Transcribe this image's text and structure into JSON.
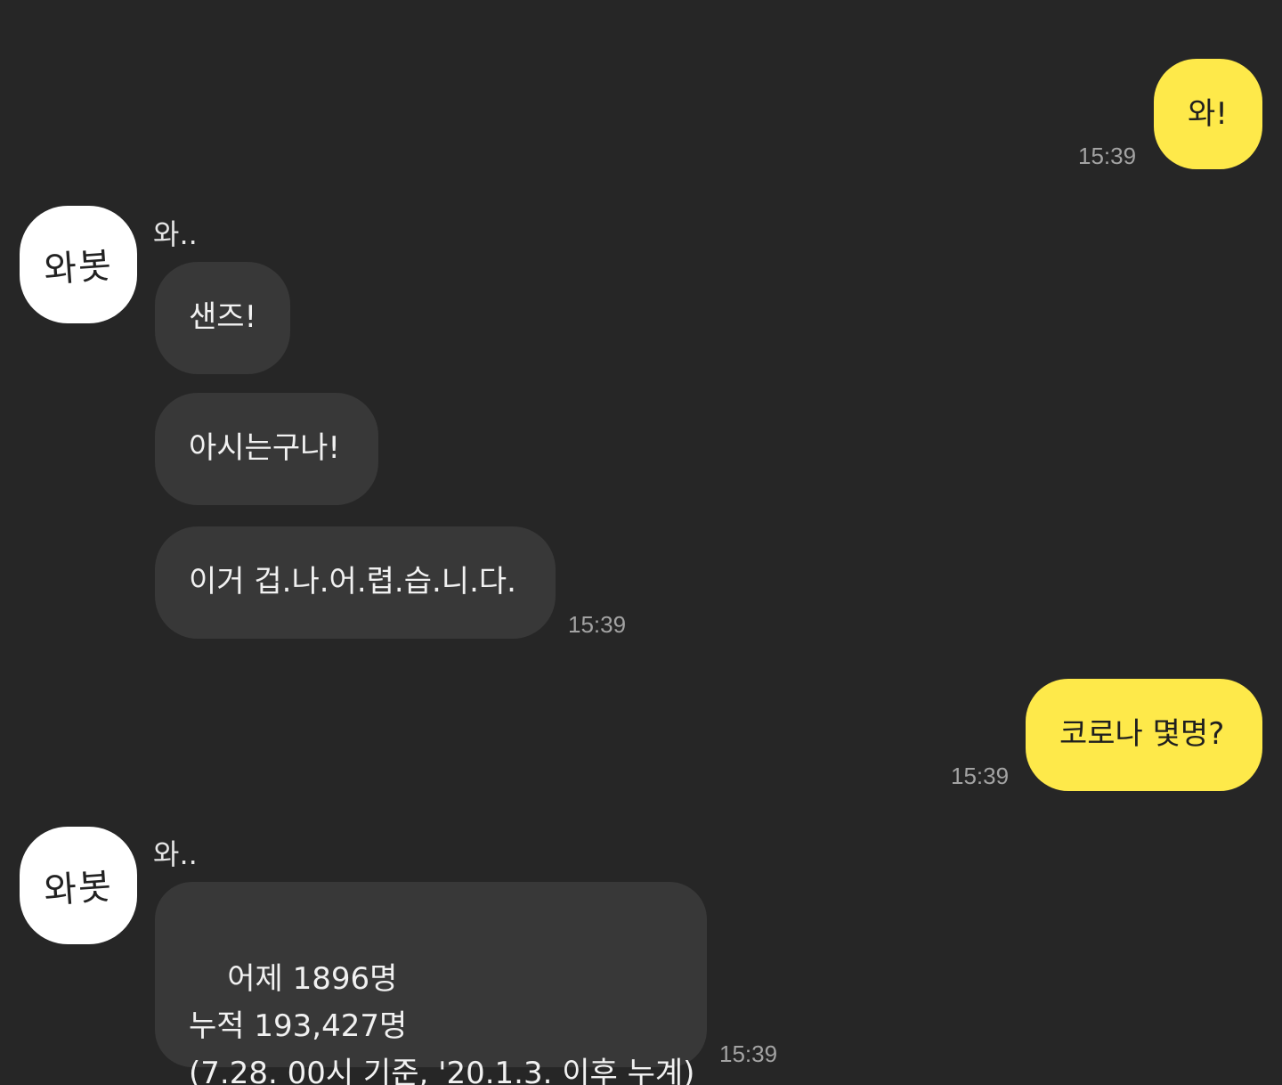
{
  "messages": {
    "m1": {
      "text": "와!",
      "time": "15:39"
    },
    "b1": {
      "sender": "와..",
      "avatar_text": "와봇",
      "texts": [
        "샌즈!",
        "아시는구나!",
        "이거 겁.나.어.렵.습.니.다."
      ],
      "time": "15:39"
    },
    "m2": {
      "text": "코로나 몇명?",
      "time": "15:39"
    },
    "b2": {
      "sender": "와..",
      "avatar_text": "와봇",
      "text": "어제 1896명\n누적 193,427명\n(7.28. 00시 기준, '20.1.3. 이후 누계)",
      "time": "15:39"
    }
  },
  "colors": {
    "background": "#262626",
    "my_bubble": "#fee94a",
    "bot_bubble": "#383838",
    "time_text": "#a3a3a3"
  },
  "icons": {
    "avatar": "wabot-avatar-icon"
  }
}
